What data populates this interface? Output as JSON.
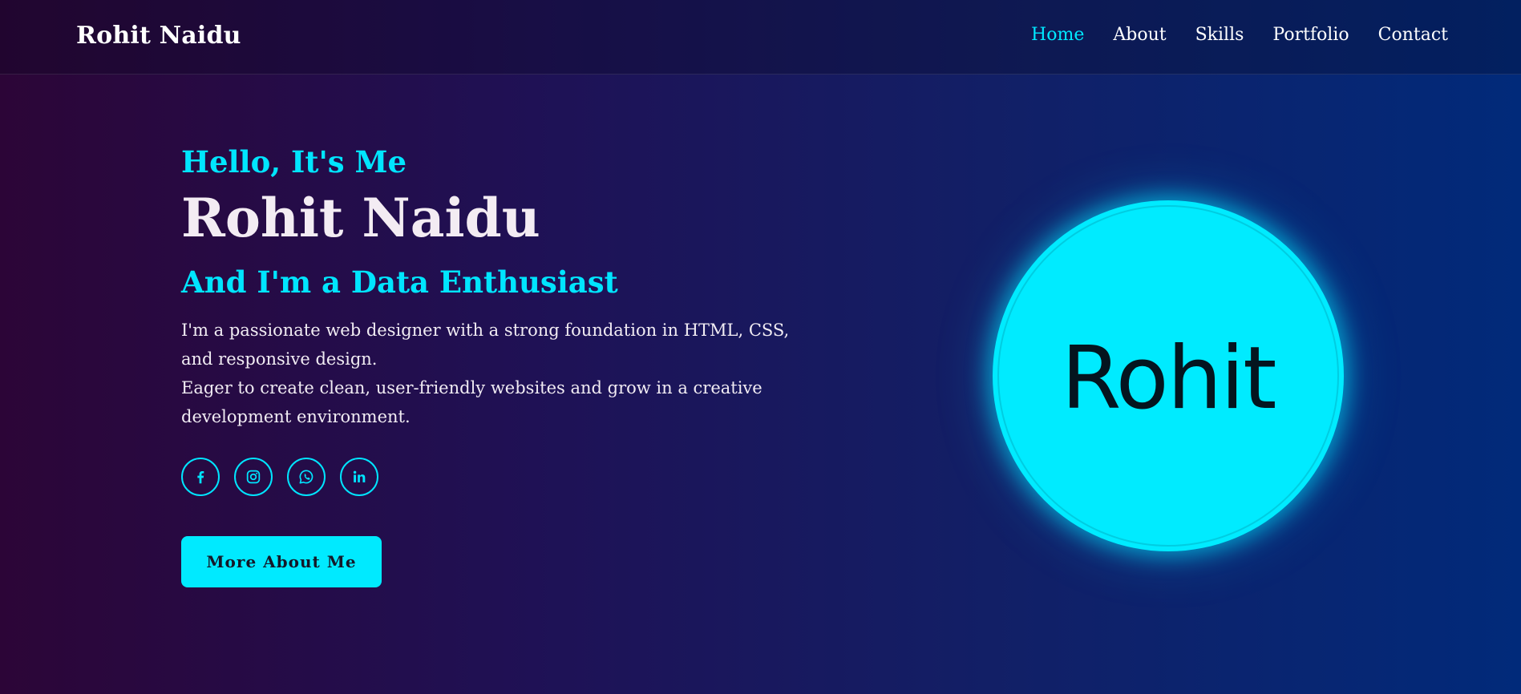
{
  "header": {
    "logo": "Rohit Naidu",
    "nav": [
      "Home",
      "About",
      "Skills",
      "Portfolio",
      "Contact"
    ],
    "active_nav": "Home"
  },
  "hero": {
    "greeting": "Hello, It's Me",
    "name": "Rohit Naidu",
    "role": "And I'm a Data Enthusiast",
    "description": [
      "I'm a passionate web designer with a strong foundation in HTML, CSS, and responsive design.",
      "Eager to create clean, user-friendly websites and grow in a creative development environment."
    ],
    "socials": [
      "facebook-icon",
      "instagram-icon",
      "whatsapp-icon",
      "linkedin-icon"
    ],
    "cta_label": "More About Me",
    "avatar_text": "Rohit"
  },
  "colors": {
    "accent": "#00e5ff",
    "text": "#f3ecf3",
    "background_start": "#2c0537",
    "background_end": "#012a7a"
  }
}
